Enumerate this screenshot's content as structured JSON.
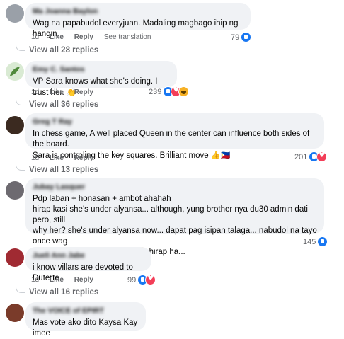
{
  "comments": [
    {
      "author": "Ma Joanna Baylon",
      "text": "Wag na papabudol everyjuan. Madaling magbago ihip ng hangin.",
      "time": "1d",
      "like_label": "Like",
      "reply_label": "Reply",
      "extra_label": "See translation",
      "reaction_count": "79",
      "reactions": [
        "like-icon"
      ],
      "view_replies": "View all 28 replies",
      "avatar_color": "#8a8f98"
    },
    {
      "author": "Emy C. Santos",
      "text": "VP Sara knows what she's doing. I trust her.",
      "text_emoji": "👏",
      "time": "1d",
      "like_label": "Like",
      "reply_label": "Reply",
      "reaction_count": "239",
      "reactions": [
        "like-icon",
        "heart-icon",
        "haha-icon"
      ],
      "view_replies": "View all 36 replies",
      "avatar_color": "#cfe3c8"
    },
    {
      "author": "Greg T Ray",
      "text_lines": [
        "In chess game, A well placed Queen in the center can influence both sides of the board.",
        "Sara is controling the key squares. Brilliant move"
      ],
      "text_emoji": "👍🇵🇭",
      "time": "1d",
      "like_label": "Like",
      "reply_label": "Reply",
      "reaction_count": "201",
      "reactions": [
        "like-icon",
        "heart-icon"
      ],
      "view_replies": "View all 13 replies",
      "avatar_color": "#3b2a20"
    },
    {
      "author": "Jubay Lasquer",
      "text_lines": [
        "Pdp laban + honasan + ambot ahahah",
        "hirap kasi she's under alyansa... although, yung brother nya du30 admin dati pero, still",
        "why her? she's under alyansa now... dapat pag isipan talaga... nabudol na tayo once wag",
        "naman na sana again now... 😞 hirap ha..."
      ],
      "reaction_count": "145",
      "reactions": [
        "like-icon"
      ],
      "avatar_color": "#6d6a70"
    },
    {
      "author": "Jueli Ann Jabe",
      "text": "i know villars are devoted to Duterte",
      "time": "1d",
      "like_label": "Like",
      "reply_label": "Reply",
      "reaction_count": "99",
      "reactions": [
        "like-icon",
        "heart-icon"
      ],
      "view_replies": "View all 16 replies",
      "avatar_color": "#a02a32"
    },
    {
      "author": "The VOICE of EPIRT",
      "text": "Mas vote ako dito Kaysa Kay imee",
      "avatar_color": "#7a3b2a"
    }
  ]
}
